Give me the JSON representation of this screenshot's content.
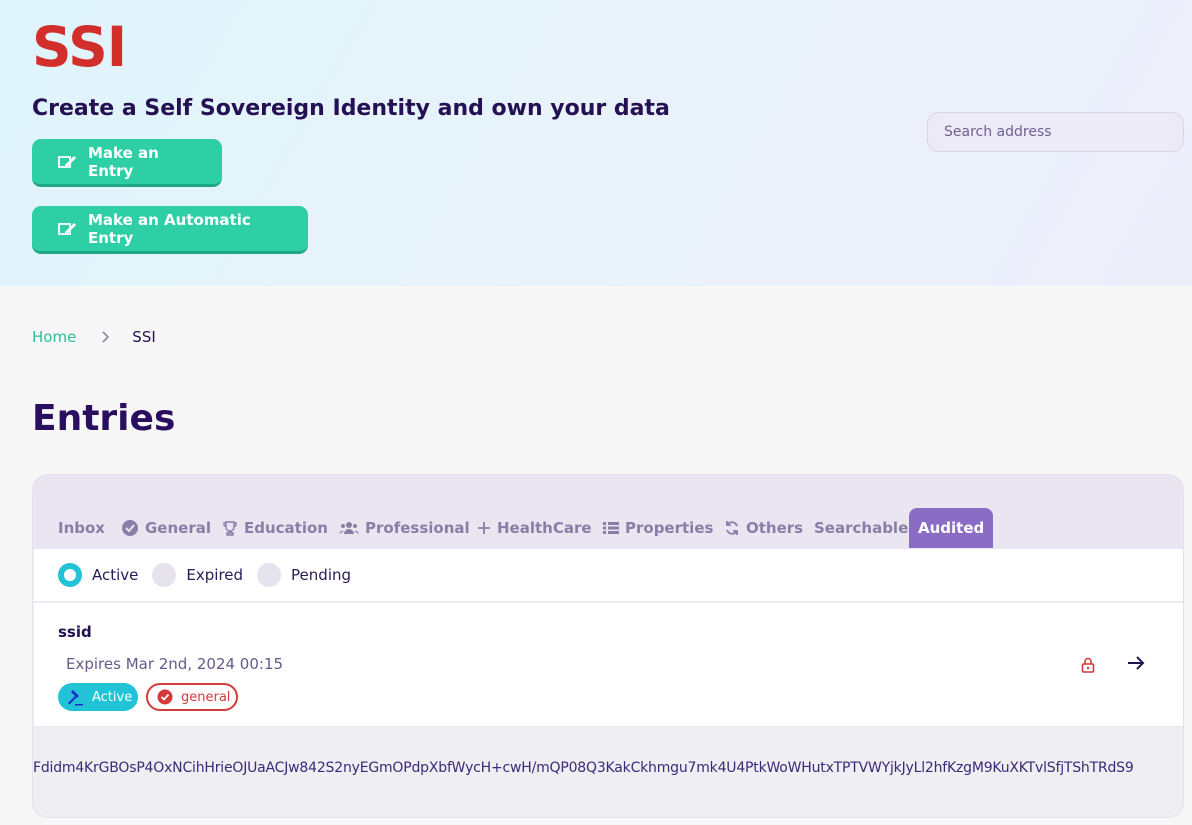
{
  "hero": {
    "logo": "SSI",
    "tagline": "Create a Self Sovereign Identity and own your data",
    "buttons": {
      "make_entry": "Make an Entry",
      "make_auto_entry": "Make an Automatic Entry"
    },
    "search": {
      "placeholder": "Search address",
      "value": ""
    }
  },
  "breadcrumb": {
    "home": "Home",
    "current": "SSI"
  },
  "page_title": "Entries",
  "tabs": [
    {
      "label": "Inbox",
      "icon": "none"
    },
    {
      "label": "General",
      "icon": "verified-badge-icon"
    },
    {
      "label": "Education",
      "icon": "trophy-icon"
    },
    {
      "label": "Professional",
      "icon": "users-icon"
    },
    {
      "label": "HealthCare",
      "icon": "plus-icon"
    },
    {
      "label": "Properties",
      "icon": "list-icon"
    },
    {
      "label": "Others",
      "icon": "refresh-icon"
    },
    {
      "label": "Searchable",
      "icon": "none"
    },
    {
      "label": "Audited",
      "icon": "none",
      "active": true
    }
  ],
  "filters": [
    {
      "label": "Active",
      "selected": true
    },
    {
      "label": "Expired",
      "selected": false
    },
    {
      "label": "Pending",
      "selected": false
    }
  ],
  "entry": {
    "name": "ssid",
    "expires": "Expires Mar 2nd, 2024 00:15",
    "status_badge": "Active",
    "category_badge": "general",
    "hash": "Fdidm4KrGBOsP4OxNCihHrieOJUaACJw842S2nyEGmOPdpXbfWycH+cwH/mQP08Q3KakCkhmgu7mk4U4PtkWoWHutxTPTVWYjkJyLl2hfKzgM9KuXKTvlSfjTShTRdS9"
  },
  "colors": {
    "brand_red": "#d22f2c",
    "accent_green": "#2fcfa6",
    "accent_cyan": "#22c3d6",
    "tab_active": "#8a6cc4",
    "text_dark": "#22104f"
  }
}
